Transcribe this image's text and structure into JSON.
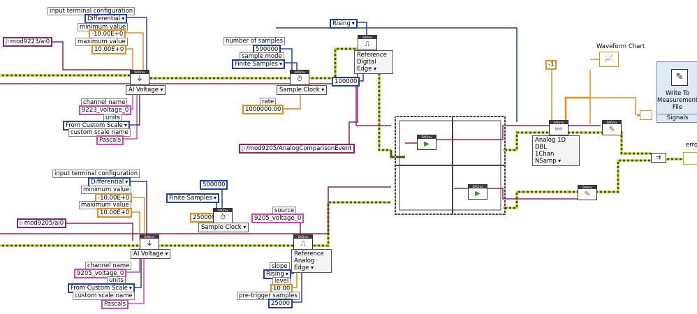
{
  "top": {
    "input_terminal_configuration": "input terminal configuration",
    "differential": "Differential",
    "minimum_value": "minimum value",
    "min": "-10.00E+0",
    "maximum_value": "maximum value",
    "max": "10.00E+0",
    "channel": "mod9223/ai0",
    "ai_voltage": "AI Voltage",
    "channel_name": "channel name",
    "channel_name_value": "9223_voltage_0",
    "units": "units",
    "units_value": "From Custom Scale",
    "custom_scale_name": "custom scale name",
    "custom_scale_value": "Pascals",
    "number_of_samples": "number of samples",
    "samples": "500000",
    "sample_mode": "sample mode",
    "sample_mode_value": "Finite Samples",
    "sample_clock": "Sample Clock",
    "rate": "rate",
    "rate_value": "1000000.00",
    "rising": "Rising",
    "reference_digital_edge": "Reference\nDigital Edge",
    "pretrigger": "100000",
    "comparison_event": "/mod9205/AnalogComparisonEvent",
    "minus_one": "-1",
    "waveform_chart": "Waveform Chart",
    "read_polymorph": "Analog 1D DBL\n1Chan NSamp",
    "write_file": "Write To\nMeasurement\nFile",
    "signals": "Signals",
    "error_out": "error o"
  },
  "bottom": {
    "input_terminal_configuration": "input terminal configuration",
    "differential": "Differential",
    "minimum_value": "minimum value",
    "min": "-10.00E+0",
    "maximum_value": "maximum value",
    "max": "10.00E+0",
    "channel": "mod9205/ai0",
    "ai_voltage": "AI Voltage",
    "channel_name": "channel name",
    "channel_name_value": "9205_voltage_0",
    "units": "units",
    "units_value": "From Custom Scale",
    "custom_scale_name": "custom scale name",
    "custom_scale_value": "Pascals",
    "samples": "500000",
    "sample_mode_value": "Finite Samples",
    "samples_short": "250000",
    "sample_clock": "Sample Clock",
    "source": "source",
    "source_value": "9205_voltage_0",
    "reference_analog_edge": "Reference\nAnalog Edge",
    "slope": "slope",
    "slope_value": "Rising",
    "level": "level",
    "level_value": "10.00",
    "pretrigger_label": "pre-trigger samples",
    "pretrigger_value": "25000"
  },
  "vi_header": "DAQmx",
  "colors": {
    "enum_blue": "#1f3fbf",
    "double_orange": "#f08a10",
    "string_pink": "#e040c0",
    "resource_purple": "#9a1c6a",
    "task_wire": "#3a9a00",
    "error_wire": "#c8b400"
  }
}
